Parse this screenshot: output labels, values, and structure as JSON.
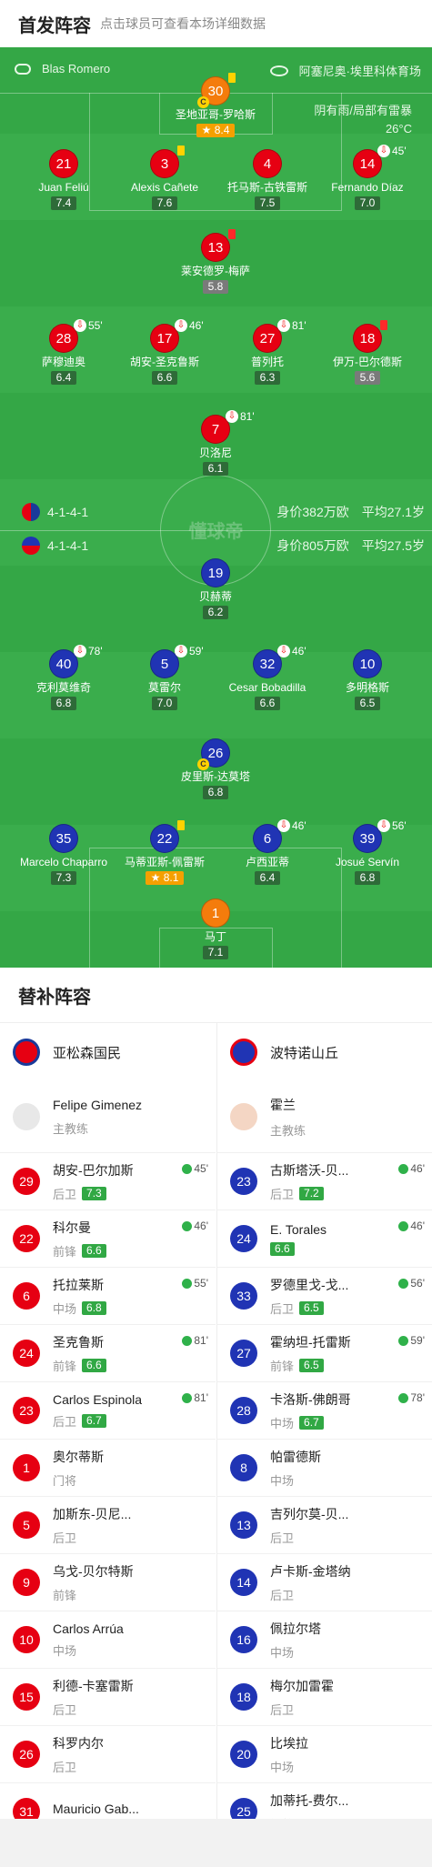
{
  "header": {
    "title": "首发阵容",
    "subtitle": "点击球员可查看本场详细数据"
  },
  "match": {
    "referee": "Blas Romero",
    "stadium": "阿塞尼奥·埃里科体育场",
    "weather": "阴有雨/局部有雷暴",
    "temperature": "26°C",
    "watermark": "懂球帝"
  },
  "home": {
    "formation": "4-1-4-1",
    "value": "身价382万欧",
    "age": "平均27.1岁"
  },
  "away": {
    "formation": "4-1-4-1",
    "value": "身价805万欧",
    "age": "平均27.5岁"
  },
  "home_players": [
    {
      "num": "30",
      "name": "圣地亚哥-罗哈斯",
      "rating": "8.4",
      "color": "orange",
      "gold": true,
      "yellow": true,
      "captain": true
    },
    {
      "num": "21",
      "name": "Juan Feliú",
      "rating": "7.4",
      "color": "red"
    },
    {
      "num": "3",
      "name": "Alexis Cañete",
      "rating": "7.6",
      "color": "red",
      "yellow": true
    },
    {
      "num": "4",
      "name": "托马斯-古铁雷斯",
      "rating": "7.5",
      "color": "red"
    },
    {
      "num": "14",
      "name": "Fernando Díaz",
      "rating": "7.0",
      "color": "red",
      "sub": "45'"
    },
    {
      "num": "13",
      "name": "莱安德罗-梅萨",
      "rating": "5.8",
      "color": "red",
      "redcard": true,
      "grey": true
    },
    {
      "num": "28",
      "name": "萨穆迪奥",
      "rating": "6.4",
      "color": "red",
      "sub": "55'"
    },
    {
      "num": "17",
      "name": "胡安-圣克鲁斯",
      "rating": "6.6",
      "color": "red",
      "sub": "46'"
    },
    {
      "num": "27",
      "name": "普列托",
      "rating": "6.3",
      "color": "red",
      "sub": "81'"
    },
    {
      "num": "18",
      "name": "伊万-巴尔德斯",
      "rating": "5.6",
      "color": "red",
      "redcard": true,
      "grey": true
    },
    {
      "num": "7",
      "name": "贝洛尼",
      "rating": "6.1",
      "color": "red",
      "sub": "81'"
    }
  ],
  "away_players": [
    {
      "num": "19",
      "name": "贝赫蒂",
      "rating": "6.2",
      "color": "blue"
    },
    {
      "num": "40",
      "name": "克利莫维奇",
      "rating": "6.8",
      "color": "blue",
      "sub": "78'"
    },
    {
      "num": "5",
      "name": "莫雷尔",
      "rating": "7.0",
      "color": "blue",
      "sub": "59'"
    },
    {
      "num": "32",
      "name": "Cesar Bobadilla",
      "rating": "6.6",
      "color": "blue",
      "yellow": true,
      "sub": "46'"
    },
    {
      "num": "10",
      "name": "多明格斯",
      "rating": "6.5",
      "color": "blue"
    },
    {
      "num": "26",
      "name": "皮里斯-达莫塔",
      "rating": "6.8",
      "color": "blue",
      "captain": true
    },
    {
      "num": "35",
      "name": "Marcelo Chaparro",
      "rating": "7.3",
      "color": "blue"
    },
    {
      "num": "22",
      "name": "马蒂亚斯-佩雷斯",
      "rating": "8.1",
      "color": "blue",
      "yellow": true,
      "gold": true
    },
    {
      "num": "6",
      "name": "卢西亚蒂",
      "rating": "6.4",
      "color": "blue",
      "yellow": true,
      "sub": "46'"
    },
    {
      "num": "39",
      "name": "Josué Servín",
      "rating": "6.8",
      "color": "blue",
      "sub": "56'"
    },
    {
      "num": "1",
      "name": "马丁",
      "rating": "7.1",
      "color": "orange"
    }
  ],
  "subs": {
    "title": "替补阵容",
    "home_team": "亚松森国民",
    "away_team": "波特诺山丘",
    "home_coach": {
      "name": "Felipe Gimenez",
      "role": "主教练"
    },
    "away_coach": {
      "name": "霍兰",
      "role": "主教练"
    },
    "home": [
      {
        "num": "29",
        "name": "胡安-巴尔加斯",
        "pos": "后卫",
        "rating": "7.3",
        "in": "45'"
      },
      {
        "num": "22",
        "name": "科尔曼",
        "pos": "前锋",
        "rating": "6.6",
        "in": "46'"
      },
      {
        "num": "6",
        "name": "托拉莱斯",
        "pos": "中场",
        "rating": "6.8",
        "in": "55'"
      },
      {
        "num": "24",
        "name": "圣克鲁斯",
        "pos": "前锋",
        "rating": "6.6",
        "in": "81'"
      },
      {
        "num": "23",
        "name": "Carlos Espinola",
        "pos": "后卫",
        "rating": "6.7",
        "in": "81'"
      },
      {
        "num": "1",
        "name": "奥尔蒂斯",
        "pos": "门将"
      },
      {
        "num": "5",
        "name": "加斯东-贝尼...",
        "pos": "后卫"
      },
      {
        "num": "9",
        "name": "乌戈-贝尔特斯",
        "pos": "前锋"
      },
      {
        "num": "10",
        "name": "Carlos Arrúa",
        "pos": "中场"
      },
      {
        "num": "15",
        "name": "利德-卡塞雷斯",
        "pos": "后卫"
      },
      {
        "num": "26",
        "name": "科罗内尔",
        "pos": "后卫"
      },
      {
        "num": "31",
        "name": "Mauricio Gab...",
        "pos": ""
      }
    ],
    "away": [
      {
        "num": "23",
        "name": "古斯塔沃-贝...",
        "pos": "后卫",
        "rating": "7.2",
        "in": "46'"
      },
      {
        "num": "24",
        "name": "E. Torales",
        "pos": "",
        "rating": "6.6",
        "in": "46'"
      },
      {
        "num": "33",
        "name": "罗德里戈-戈...",
        "pos": "后卫",
        "rating": "6.5",
        "in": "56'"
      },
      {
        "num": "27",
        "name": "霍纳坦-托雷斯",
        "pos": "前锋",
        "rating": "6.5",
        "in": "59'"
      },
      {
        "num": "28",
        "name": "卡洛斯-佛朗哥",
        "pos": "中场",
        "rating": "6.7",
        "in": "78'"
      },
      {
        "num": "8",
        "name": "帕雷德斯",
        "pos": "中场"
      },
      {
        "num": "13",
        "name": "吉列尔莫-贝...",
        "pos": "后卫"
      },
      {
        "num": "14",
        "name": "卢卡斯-金塔纳",
        "pos": "后卫"
      },
      {
        "num": "16",
        "name": "佩拉尔塔",
        "pos": "中场"
      },
      {
        "num": "18",
        "name": "梅尔加雷霍",
        "pos": "后卫"
      },
      {
        "num": "20",
        "name": "比埃拉",
        "pos": "中场"
      },
      {
        "num": "25",
        "name": "加蒂托-费尔...",
        "pos": "门将"
      }
    ]
  }
}
